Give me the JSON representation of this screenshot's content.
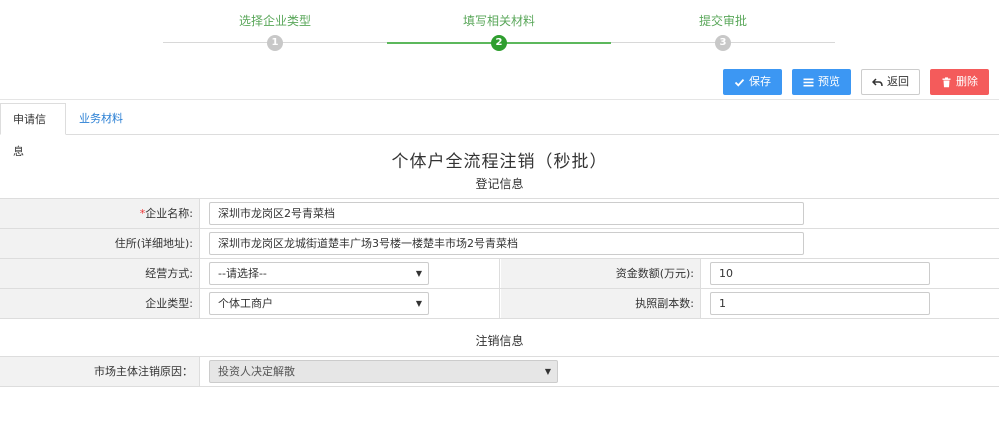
{
  "stepper": {
    "steps": [
      {
        "label": "选择企业类型",
        "number": "1",
        "state": "done"
      },
      {
        "label": "填写相关材料",
        "number": "2",
        "state": "active"
      },
      {
        "label": "提交审批",
        "number": "3",
        "state": "pending"
      }
    ]
  },
  "toolbar": {
    "save_label": "保存",
    "preview_label": "预览",
    "back_label": "返回",
    "delete_label": "删除"
  },
  "tabs": [
    {
      "label": "申请信息",
      "active": true
    },
    {
      "label": "业务材料",
      "active": false
    }
  ],
  "form": {
    "title": "个体户全流程注销（秒批）",
    "registration_section": "登记信息",
    "company_name": {
      "label": "企业名称:",
      "required_mark": "*",
      "value": "深圳市龙岗区2号青菜档"
    },
    "address": {
      "label": "住所(详细地址):",
      "value": "深圳市龙岗区龙城街道楚丰广场3号楼一楼楚丰市场2号青菜档"
    },
    "operation_mode": {
      "label": "经营方式:",
      "value": "--请选择--"
    },
    "capital": {
      "label": "资金数额(万元):",
      "value": "10"
    },
    "company_type": {
      "label": "企业类型:",
      "value": "个体工商户"
    },
    "license_copies": {
      "label": "执照副本数:",
      "value": "1"
    },
    "cancellation_section": "注销信息",
    "cancel_reason": {
      "label": "市场主体注销原因：",
      "value": "投资人决定解散"
    }
  },
  "colors": {
    "primary": "#3c97f3",
    "danger": "#f45b5b",
    "success": "#2f9e2f",
    "link": "#2a7fd4"
  }
}
